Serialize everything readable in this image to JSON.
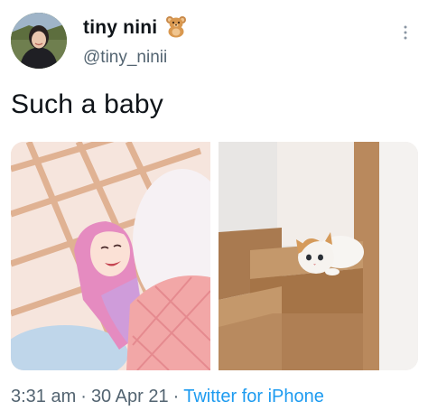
{
  "author": {
    "display_name": "tiny nini",
    "handle": "@tiny_ninii",
    "badge_icon": "teddy-bear-icon"
  },
  "tweet": {
    "text": "Such a baby"
  },
  "media": [
    {
      "name": "girl-pink-hair-photo"
    },
    {
      "name": "cat-on-stairs-photo"
    }
  ],
  "meta": {
    "time": "3:31 am",
    "separator": "·",
    "date": "30 Apr 21",
    "source": "Twitter for iPhone"
  },
  "colors": {
    "text": "#0f1419",
    "secondary": "#536471",
    "link": "#1d9bf0"
  }
}
